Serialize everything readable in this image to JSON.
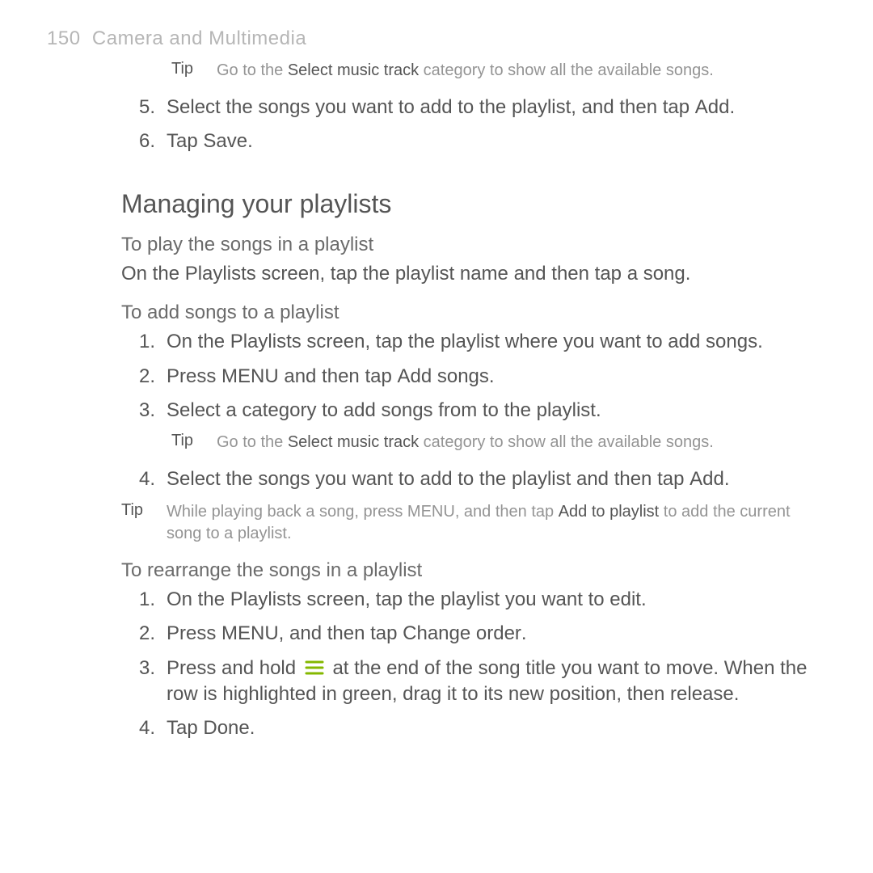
{
  "header": {
    "page_num": "150",
    "section": "Camera and Multimedia"
  },
  "tip1": {
    "label": "Tip",
    "pre": "Go to the ",
    "strong": "Select music track",
    "post": " category to show all the available songs."
  },
  "list1": {
    "i5n": "5.",
    "i5a": "Select the songs you want to add to the playlist, and then tap ",
    "i5b": "Add",
    "i5c": ".",
    "i6n": "6.",
    "i6a": "Tap ",
    "i6b": "Save",
    "i6c": "."
  },
  "h2": "Managing your playlists",
  "secA": {
    "h3": "To play the songs in a playlist",
    "p1": "On the Playlists screen, tap the playlist name and then tap a song."
  },
  "secB": {
    "h3": "To add songs to a playlist",
    "i1n": "1.",
    "i1": "On the Playlists screen, tap the playlist where you want to add songs.",
    "i2n": "2.",
    "i2a": "Press MENU and then tap ",
    "i2b": "Add songs",
    "i2c": ".",
    "i3n": "3.",
    "i3": "Select a category to add songs from to the playlist.",
    "tip": {
      "label": "Tip",
      "pre": "Go to the ",
      "strong": "Select music track",
      "post": " category to show all the available songs."
    },
    "i4n": "4.",
    "i4a": "Select the songs you want to add to the playlist and then tap ",
    "i4b": "Add",
    "i4c": "."
  },
  "tip2": {
    "label": "Tip",
    "pre": "While playing back a song, press MENU, and then tap ",
    "strong": "Add to playlist",
    "post": " to add the current song to a playlist."
  },
  "secC": {
    "h3": "To rearrange the songs in a playlist",
    "i1n": "1.",
    "i1": "On the Playlists screen, tap the playlist you want to edit.",
    "i2n": "2.",
    "i2a": "Press MENU, and then tap ",
    "i2b": "Change order",
    "i2c": ".",
    "i3n": "3.",
    "i3a": "Press and hold ",
    "i3b": " at the end of the song title you want to move. When the row is highlighted in green, drag it to its new position, then release.",
    "i4n": "4.",
    "i4a": "Tap ",
    "i4b": "Done",
    "i4c": "."
  }
}
